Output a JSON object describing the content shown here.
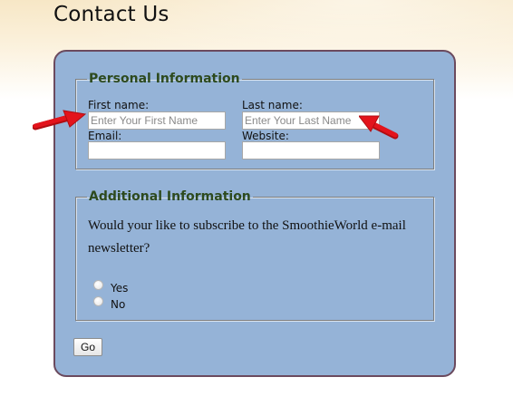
{
  "page": {
    "title": "Contact Us"
  },
  "personal": {
    "legend": "Personal Information",
    "first_name_label": "First name:",
    "first_name_placeholder": "Enter Your First Name",
    "last_name_label": "Last name:",
    "last_name_placeholder": "Enter Your Last Name",
    "email_label": "Email:",
    "website_label": "Website:"
  },
  "additional": {
    "legend": "Additional Information",
    "question": "Would your like to subscribe to the SmoothieWorld e-mail newsletter?",
    "options": [
      "Yes",
      "No"
    ]
  },
  "form": {
    "submit_label": "Go"
  },
  "colors": {
    "panel_bg": "#95b3d7",
    "panel_border": "#6b4a5e",
    "legend_text": "#2d4a1e",
    "arrow": "#e3141c"
  },
  "icons": [
    "red-arrow-icon"
  ]
}
